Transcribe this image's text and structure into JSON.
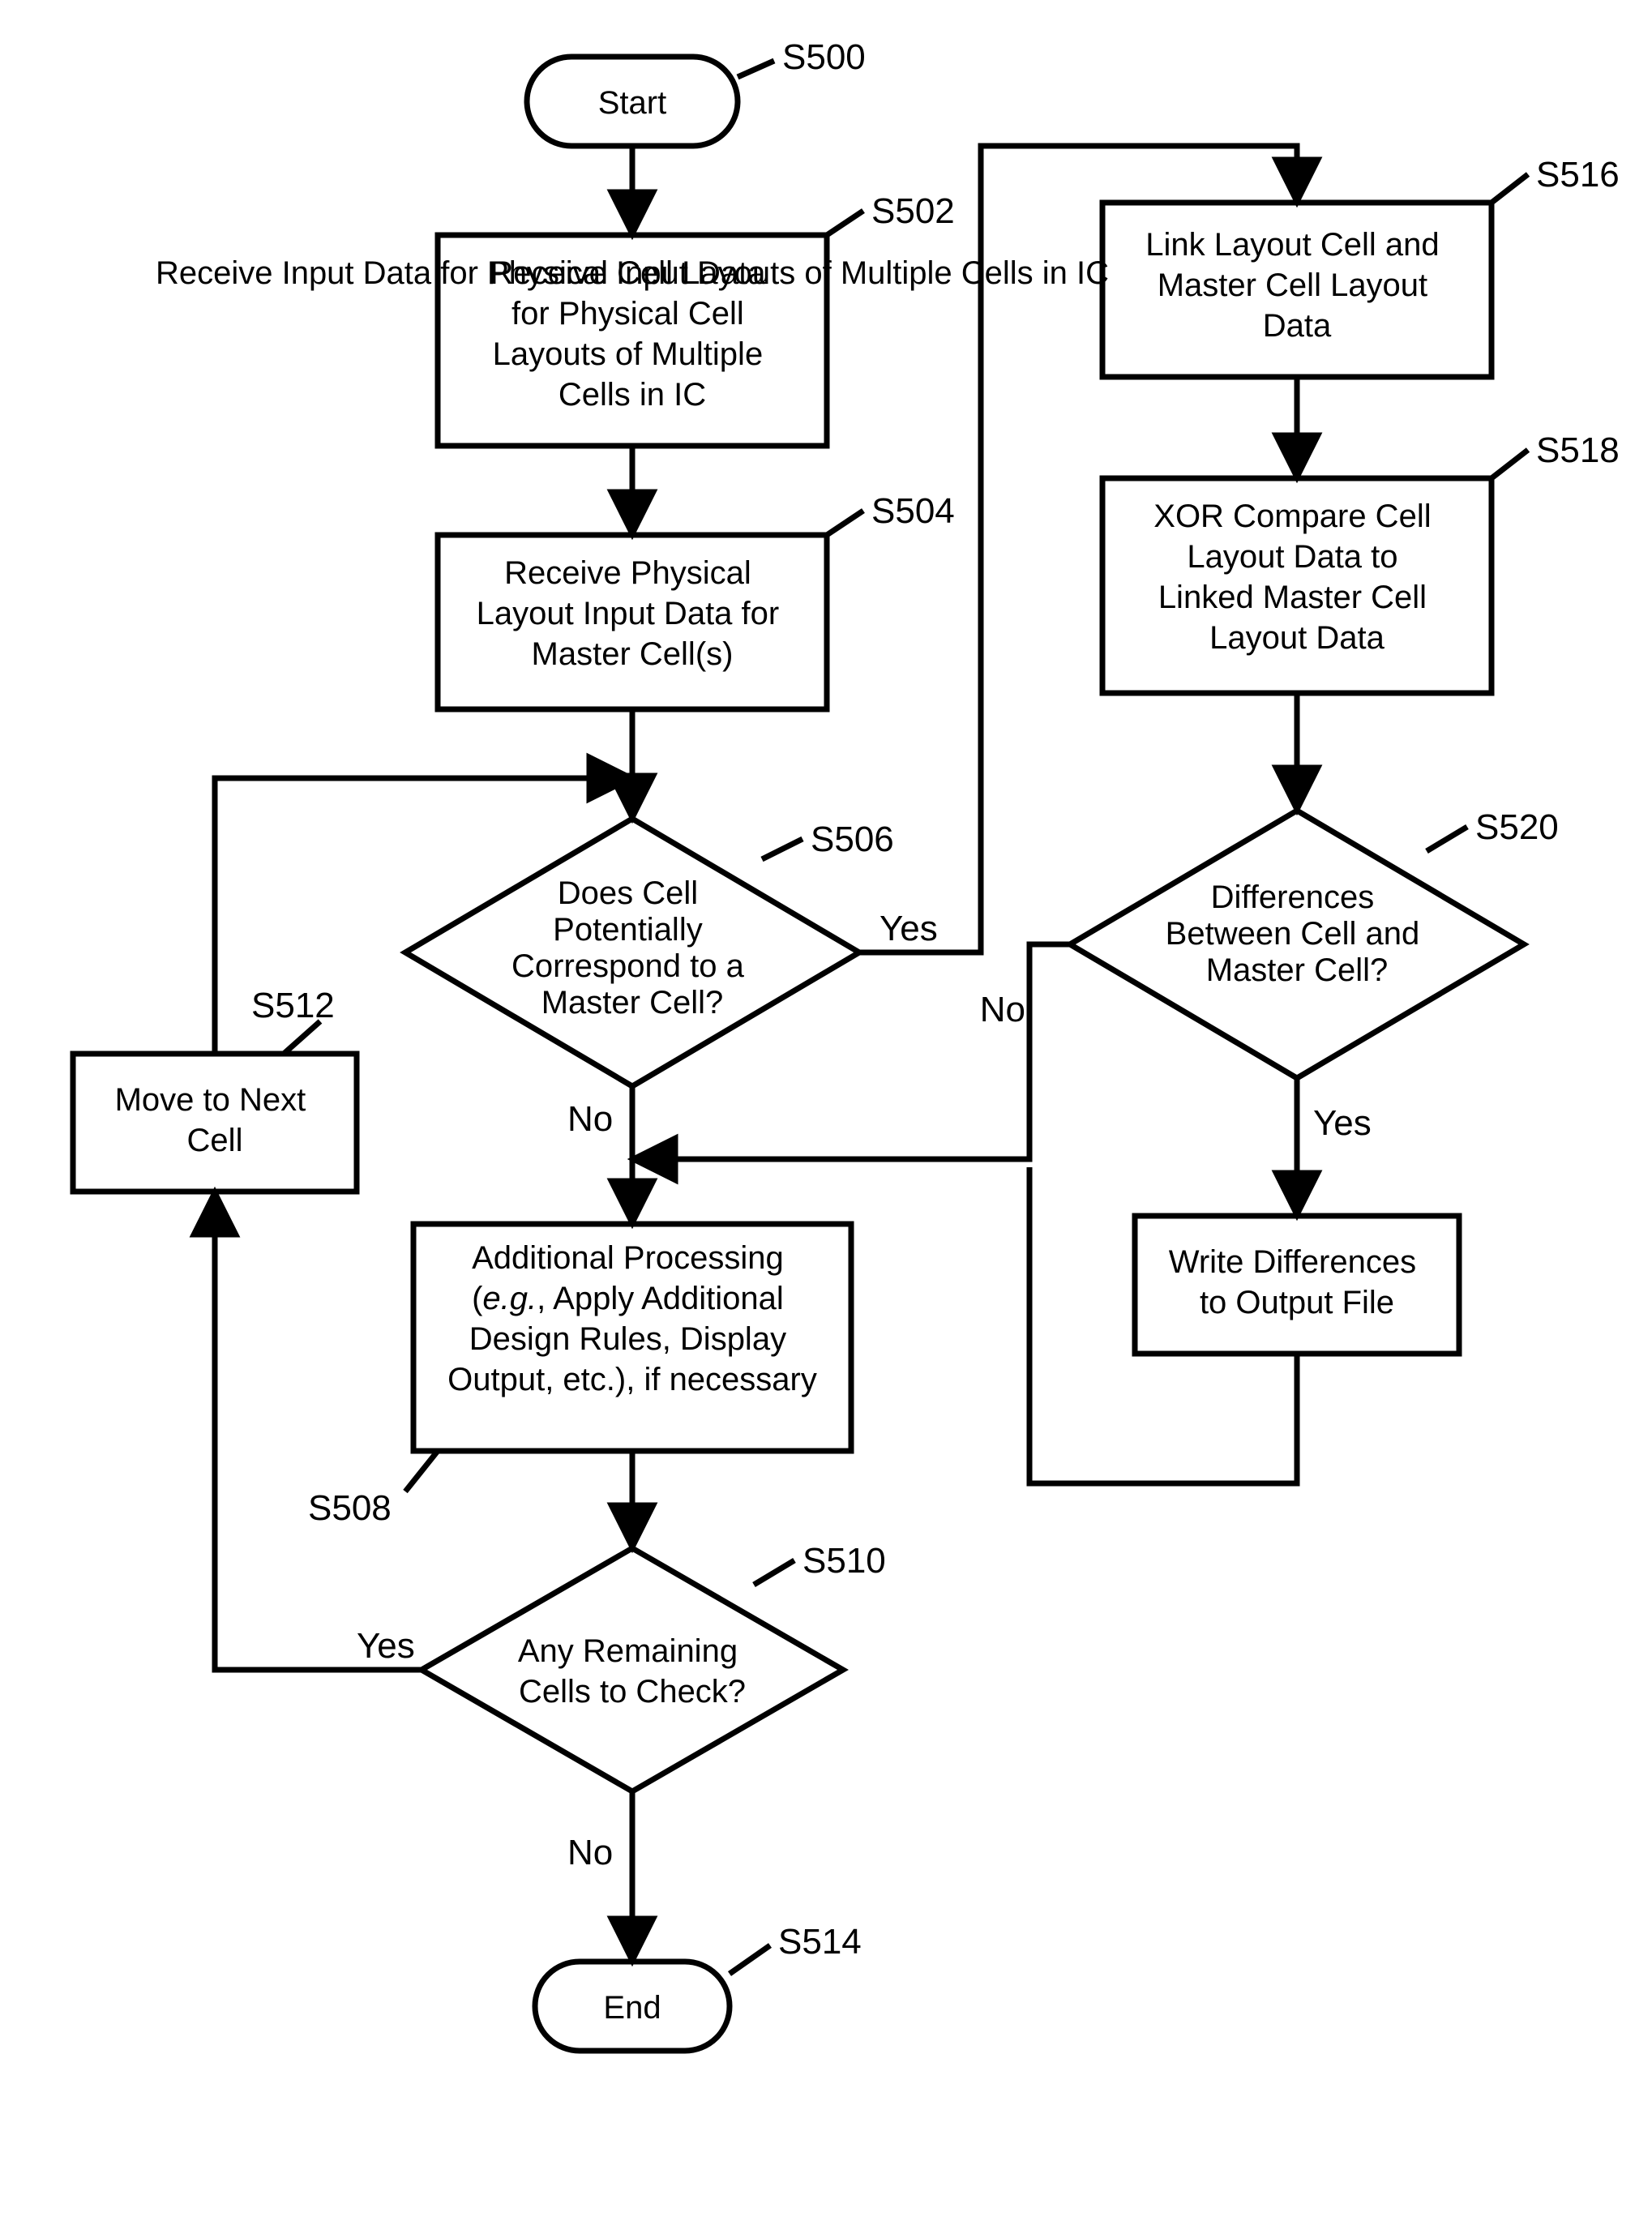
{
  "nodes": {
    "start": {
      "text": "Start",
      "label": "S500"
    },
    "s502": {
      "text": "Receive Input Data for Physical Cell Layouts of Multiple Cells in IC",
      "label": "S502"
    },
    "s504": {
      "text": "Receive Physical Layout Input Data for Master Cell(s)",
      "label": "S504"
    },
    "s506": {
      "text": "Does Cell Potentially Correspond to a Master Cell?",
      "label": "S506"
    },
    "s508": {
      "text": "Additional Processing (e.g., Apply Additional Design Rules, Display Output, etc.), if necessary",
      "label": "S508"
    },
    "s510": {
      "text": "Any Remaining Cells to Check?",
      "label": "S510"
    },
    "s512": {
      "text": "Move to Next Cell",
      "label": "S512"
    },
    "end": {
      "text": "End",
      "label": "S514"
    },
    "s516": {
      "text": "Link Layout Cell and Master Cell Layout Data",
      "label": "S516"
    },
    "s518": {
      "text": "XOR Compare Cell Layout Data to Linked Master Cell Layout Data",
      "label": "S518"
    },
    "s520": {
      "text": "Differences Between Cell and Master Cell?",
      "label": "S520"
    },
    "s522": {
      "text": "Write Differences to Output File"
    }
  },
  "edges": {
    "yes": "Yes",
    "no": "No"
  }
}
